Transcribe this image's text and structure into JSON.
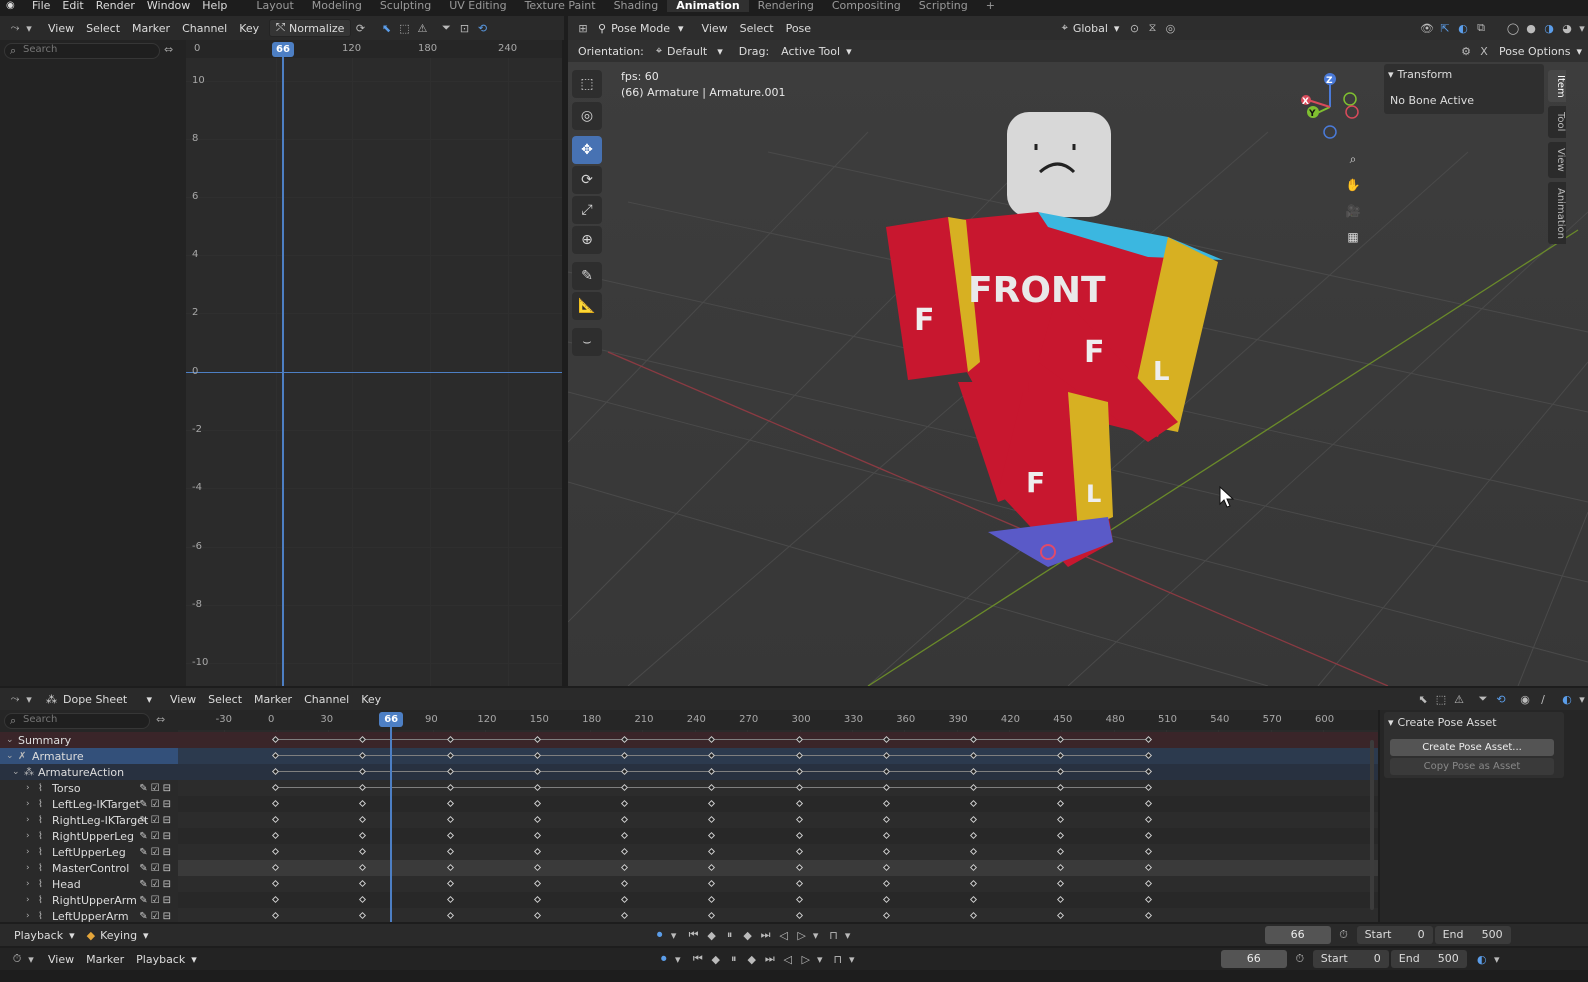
{
  "topbar": {
    "menus": [
      "File",
      "Edit",
      "Render",
      "Window",
      "Help"
    ],
    "workspaces": [
      "Layout",
      "Modeling",
      "Sculpting",
      "UV Editing",
      "Texture Paint",
      "Shading",
      "Animation",
      "Rendering",
      "Compositing",
      "Scripting"
    ],
    "active_workspace": "Animation",
    "add_tab": "+"
  },
  "graph_editor": {
    "menus": [
      "View",
      "Select",
      "Marker",
      "Channel",
      "Key"
    ],
    "normalize_label": "Normalize",
    "search_placeholder": "Search",
    "x_ticks": [
      "0",
      "120",
      "180",
      "240"
    ],
    "y_ticks": [
      "10",
      "8",
      "6",
      "4",
      "2",
      "0",
      "-2",
      "-4",
      "-6",
      "-8",
      "-10"
    ],
    "current_frame": "66"
  },
  "viewport": {
    "mode_label": "Pose Mode",
    "menus": [
      "View",
      "Select",
      "Pose"
    ],
    "orientation_label": "Orientation:",
    "orientation_value": "Default",
    "drag_label": "Drag:",
    "drag_value": "Active Tool",
    "transform_space": "Global",
    "pose_options": "Pose Options",
    "overlay_fps": "fps: 60",
    "overlay_object": "(66) Armature | Armature.001",
    "model_labels": [
      "FRONT",
      "F",
      "F",
      "L",
      "F",
      "L"
    ],
    "gizmo_axes": [
      "Z",
      "Y",
      "X"
    ],
    "sidebar": {
      "panel_title": "Transform",
      "message": "No Bone Active",
      "tabs": [
        "Item",
        "Tool",
        "View",
        "Animation"
      ]
    }
  },
  "dope_sheet": {
    "editor_label": "Dope Sheet",
    "menus": [
      "View",
      "Select",
      "Marker",
      "Channel",
      "Key"
    ],
    "search_placeholder": "Search",
    "frame_ticks": [
      {
        "frame": -30,
        "label": "-30"
      },
      {
        "frame": 0,
        "label": "0"
      },
      {
        "frame": 30,
        "label": "30"
      },
      {
        "frame": 90,
        "label": "90"
      },
      {
        "frame": 120,
        "label": "120"
      },
      {
        "frame": 150,
        "label": "150"
      },
      {
        "frame": 180,
        "label": "180"
      },
      {
        "frame": 210,
        "label": "210"
      },
      {
        "frame": 240,
        "label": "240"
      },
      {
        "frame": 270,
        "label": "270"
      },
      {
        "frame": 300,
        "label": "300"
      },
      {
        "frame": 330,
        "label": "330"
      },
      {
        "frame": 360,
        "label": "360"
      },
      {
        "frame": 390,
        "label": "390"
      },
      {
        "frame": 420,
        "label": "420"
      },
      {
        "frame": 450,
        "label": "450"
      },
      {
        "frame": 480,
        "label": "480"
      },
      {
        "frame": 510,
        "label": "510"
      },
      {
        "frame": 540,
        "label": "540"
      },
      {
        "frame": 570,
        "label": "570"
      },
      {
        "frame": 600,
        "label": "600"
      }
    ],
    "current_frame": "66",
    "keyframes": [
      0,
      50,
      100,
      150,
      200,
      250,
      300,
      350,
      400,
      450,
      500
    ],
    "channels": [
      {
        "label": "Summary",
        "kind": "summary"
      },
      {
        "label": "Armature",
        "kind": "object"
      },
      {
        "label": "ArmatureAction",
        "kind": "action"
      },
      {
        "label": "Torso",
        "kind": "bone"
      },
      {
        "label": "LeftLeg-IKTarget",
        "kind": "bone"
      },
      {
        "label": "RightLeg-IKTarget",
        "kind": "bone"
      },
      {
        "label": "RightUpperLeg",
        "kind": "bone"
      },
      {
        "label": "LeftUpperLeg",
        "kind": "bone"
      },
      {
        "label": "MasterControl",
        "kind": "bone"
      },
      {
        "label": "Head",
        "kind": "bone"
      },
      {
        "label": "RightUpperArm",
        "kind": "bone"
      },
      {
        "label": "LeftUpperArm",
        "kind": "bone"
      }
    ],
    "sidebar": {
      "panel_title": "Create Pose Asset",
      "create_button": "Create Pose Asset...",
      "copy_button": "Copy Pose as Asset"
    }
  },
  "playback_row": {
    "playback_label": "Playback",
    "keying_label": "Keying",
    "current_frame": "66",
    "start_label": "Start",
    "start_value": "0",
    "end_label": "End",
    "end_value": "500"
  },
  "timeline_row": {
    "menus": [
      "View",
      "Marker",
      "Playback"
    ],
    "current_frame": "66",
    "start_label": "Start",
    "start_value": "0",
    "end_label": "End",
    "end_value": "500"
  }
}
